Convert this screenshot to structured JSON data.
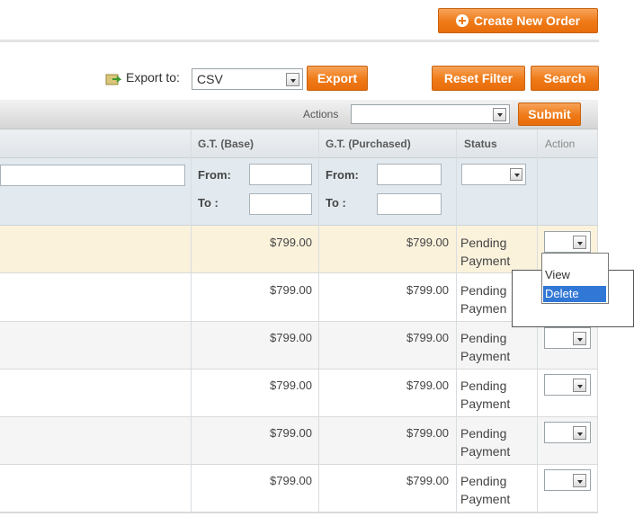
{
  "header": {
    "create_order_label": "Create New Order"
  },
  "export": {
    "label": "Export to:",
    "format_value": "CSV",
    "export_button": "Export"
  },
  "toolbar": {
    "reset_filter": "Reset Filter",
    "search": "Search"
  },
  "mass_actions": {
    "label": "Actions",
    "submit": "Submit"
  },
  "columns": {
    "gt_base": "G.T. (Base)",
    "gt_purchased": "G.T. (Purchased)",
    "status": "Status",
    "action": "Action"
  },
  "filters": {
    "from_label": "From:",
    "to_label": "To :"
  },
  "rows": [
    {
      "gt_base": "$799.00",
      "gt_purchased": "$799.00",
      "status_line1": "Pending",
      "status_line2": "Payment"
    },
    {
      "gt_base": "$799.00",
      "gt_purchased": "$799.00",
      "status_line1": "Pending",
      "status_line2": "Paymen"
    },
    {
      "gt_base": "$799.00",
      "gt_purchased": "$799.00",
      "status_line1": "Pending",
      "status_line2": "Payment"
    },
    {
      "gt_base": "$799.00",
      "gt_purchased": "$799.00",
      "status_line1": "Pending",
      "status_line2": "Payment"
    },
    {
      "gt_base": "$799.00",
      "gt_purchased": "$799.00",
      "status_line1": "Pending",
      "status_line2": "Payment"
    },
    {
      "gt_base": "$799.00",
      "gt_purchased": "$799.00",
      "status_line1": "Pending",
      "status_line2": "Payment"
    }
  ],
  "action_dropdown": {
    "options": [
      "View",
      "Delete"
    ],
    "selected": "Delete"
  },
  "colors": {
    "accent_orange": "#ef7a17",
    "highlight_row": "#fbf2dc",
    "selected_option": "#3178d6"
  }
}
